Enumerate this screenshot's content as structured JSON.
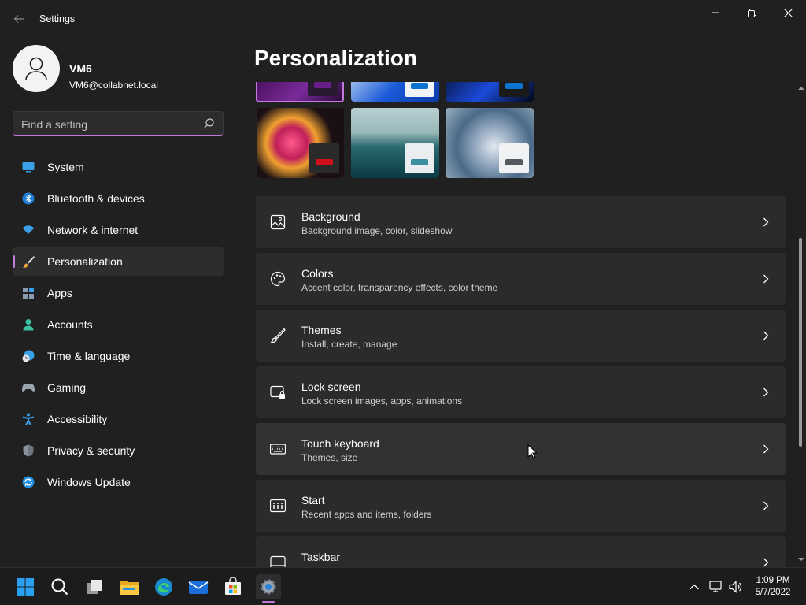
{
  "window": {
    "title": "Settings",
    "back_icon": "back-arrow-icon",
    "controls": [
      "minimize-icon",
      "maximize-icon",
      "close-icon"
    ]
  },
  "profile": {
    "name": "VM6",
    "email": "VM6@collabnet.local"
  },
  "search": {
    "placeholder": "Find a setting",
    "value": ""
  },
  "sidebar": {
    "items": [
      {
        "label": "System",
        "icon": "monitor-icon",
        "active": false
      },
      {
        "label": "Bluetooth & devices",
        "icon": "bluetooth-icon",
        "active": false
      },
      {
        "label": "Network & internet",
        "icon": "wifi-icon",
        "active": false
      },
      {
        "label": "Personalization",
        "icon": "paintbrush-icon",
        "active": true
      },
      {
        "label": "Apps",
        "icon": "apps-icon",
        "active": false
      },
      {
        "label": "Accounts",
        "icon": "person-icon",
        "active": false
      },
      {
        "label": "Time & language",
        "icon": "clock-globe-icon",
        "active": false
      },
      {
        "label": "Gaming",
        "icon": "gamepad-icon",
        "active": false
      },
      {
        "label": "Accessibility",
        "icon": "accessibility-icon",
        "active": false
      },
      {
        "label": "Privacy & security",
        "icon": "shield-icon",
        "active": false
      },
      {
        "label": "Windows Update",
        "icon": "update-icon",
        "active": false
      }
    ],
    "accent_color": "#c27bd8"
  },
  "main": {
    "title": "Personalization",
    "themes": [
      {
        "name": "glow-theme",
        "swatch": "#6a1e8a"
      },
      {
        "name": "bloom-light-theme",
        "swatch": "#0a74d0"
      },
      {
        "name": "bloom-dark-theme",
        "swatch": "#0a74d0"
      },
      {
        "name": "captured-motion-theme",
        "swatch": "#d0101a"
      },
      {
        "name": "sunrise-theme",
        "swatch": "#3a8e9e"
      },
      {
        "name": "flow-theme",
        "swatch": "#555a60"
      }
    ],
    "cards": [
      {
        "title": "Background",
        "subtitle": "Background image, color, slideshow",
        "icon": "image-icon"
      },
      {
        "title": "Colors",
        "subtitle": "Accent color, transparency effects, color theme",
        "icon": "palette-icon"
      },
      {
        "title": "Themes",
        "subtitle": "Install, create, manage",
        "icon": "pen-brush-icon"
      },
      {
        "title": "Lock screen",
        "subtitle": "Lock screen images, apps, animations",
        "icon": "lock-screen-icon"
      },
      {
        "title": "Touch keyboard",
        "subtitle": "Themes, size",
        "icon": "keyboard-icon"
      },
      {
        "title": "Start",
        "subtitle": "Recent apps and items, folders",
        "icon": "start-grid-icon"
      },
      {
        "title": "Taskbar",
        "subtitle": "",
        "icon": "taskbar-icon"
      }
    ]
  },
  "taskbar": {
    "apps": [
      "windows-start-icon",
      "search-icon",
      "task-view-icon",
      "file-explorer-icon",
      "edge-icon",
      "mail-icon",
      "store-icon",
      "settings-gear-icon"
    ],
    "tray": [
      "chevron-up-icon",
      "network-monitor-icon",
      "speaker-icon"
    ],
    "time": "1:09 PM",
    "date": "5/7/2022"
  }
}
